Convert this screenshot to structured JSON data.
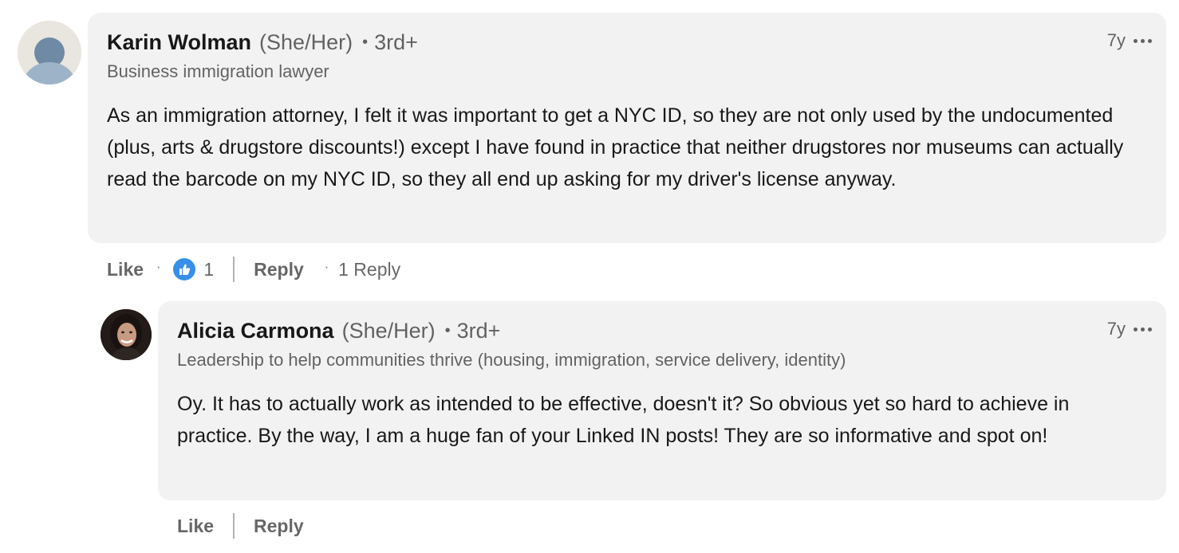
{
  "comments": [
    {
      "author": "Karin Wolman",
      "pronouns": "(She/Her)",
      "degree": "3rd+",
      "headline": "Business immigration lawyer",
      "time": "7y",
      "text": "As an immigration attorney, I felt it was important to get a NYC ID, so they are not only used by the undocumented (plus, arts & drugstore discounts!) except I have found in practice that neither drugstores nor museums can actually read the barcode on my NYC ID, so they all end up asking for my driver's license anyway.",
      "actions": {
        "like_label": "Like",
        "reaction_count": "1",
        "reply_label": "Reply",
        "replies_label": "1 Reply"
      }
    },
    {
      "author": "Alicia Carmona",
      "pronouns": "(She/Her)",
      "degree": "3rd+",
      "headline": "Leadership to help communities thrive (housing, immigration, service delivery, identity)",
      "time": "7y",
      "text": "Oy. It has to actually work as intended to be effective, doesn't it? So obvious yet so hard to achieve in practice. By the way, I am a huge fan of your Linked IN posts! They are so informative and spot on!",
      "actions": {
        "like_label": "Like",
        "reply_label": "Reply"
      }
    }
  ],
  "icons": {
    "reaction": "like-reaction-icon",
    "more": "more-options-icon",
    "avatar_placeholder": "default-avatar-icon"
  },
  "colors": {
    "bubble_bg": "#f2f2f2",
    "reaction_blue": "#378fe9",
    "placeholder_avatar_bg": "#e9e5df",
    "placeholder_avatar_fg": "#9db3c8"
  }
}
